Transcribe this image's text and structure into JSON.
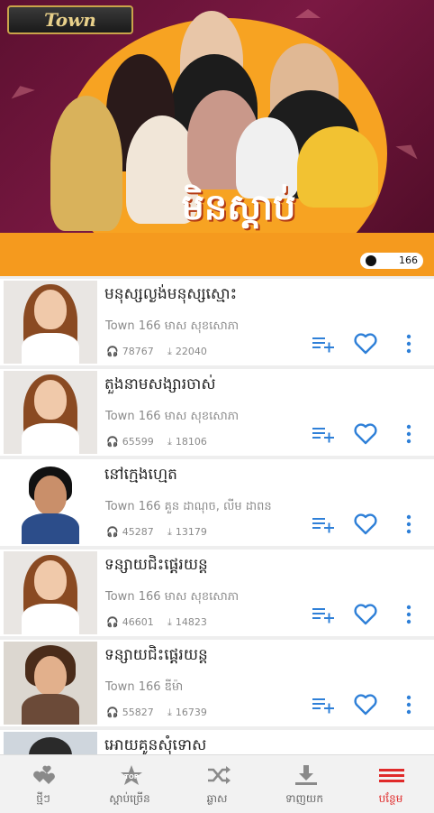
{
  "banner": {
    "logo": "Town",
    "title": "មិនស្តាប់",
    "badge": "166"
  },
  "songs": [
    {
      "title": "មនុស្សល្ងង់មនុស្សស្មោះ",
      "artist": "Town 166  មាស សុខសោភា",
      "listens": "78767",
      "downloads": "22040"
    },
    {
      "title": "តួងនាមសង្សារចាស់",
      "artist": "Town 166  មាស សុខសោភា",
      "listens": "65599",
      "downloads": "18106"
    },
    {
      "title": "នៅក្មេងហ្មេត",
      "artist": "Town 166  គួន ដាណុច, លីម ដាពន",
      "listens": "45287",
      "downloads": "13179"
    },
    {
      "title": "ទន្សាយជិះផ្តេ្ករយន្ត",
      "artist": "Town 166  មាស សុខសោភា",
      "listens": "46601",
      "downloads": "14823"
    },
    {
      "title": "ទន្សាយជិះផ្តេ្ករយន្ត",
      "artist": "Town 166  ឌីម៉ា",
      "listens": "55827",
      "downloads": "16739"
    },
    {
      "title": "អោយគូនសុំទោស",
      "artist": "",
      "listens": "",
      "downloads": ""
    }
  ],
  "icons": {
    "headphones": "headphones-icon",
    "download": "download-icon",
    "add_playlist": "add-to-playlist-icon",
    "favorite": "heart-icon",
    "more": "more-vertical-icon"
  },
  "nav": [
    {
      "label": "ថ្មីៗ",
      "icon": "new-hearts-icon"
    },
    {
      "label": "ស្តាប់ច្រើន",
      "icon": "top-icon",
      "badge": "TOP"
    },
    {
      "label": "ឆ្លាស",
      "icon": "shuffle-icon"
    },
    {
      "label": "ទាញយក",
      "icon": "download-icon"
    },
    {
      "label": "បន្ថែម",
      "icon": "menu-icon"
    }
  ],
  "colors": {
    "accent": "#2f80d8",
    "active_nav": "#e02a2a",
    "banner_orange": "#f59a1e"
  }
}
